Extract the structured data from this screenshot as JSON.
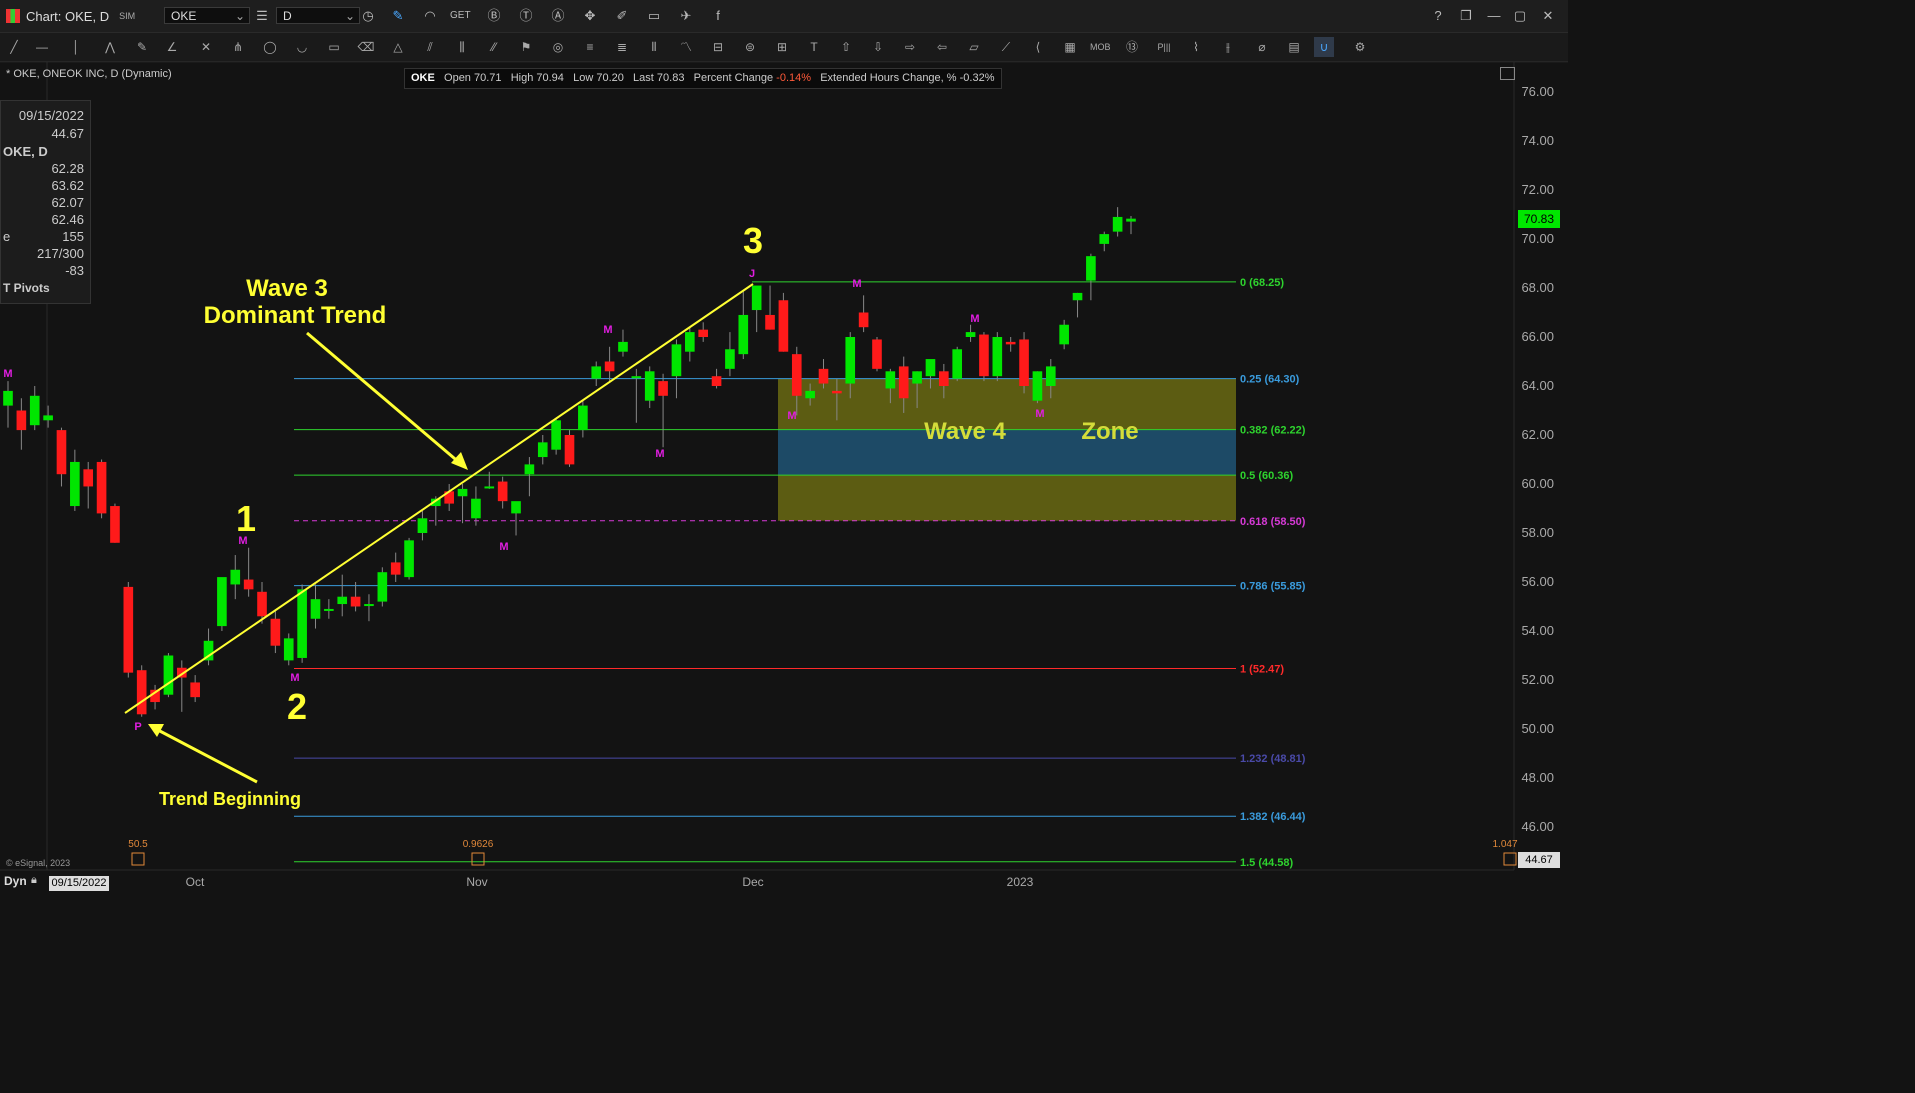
{
  "window": {
    "title": "Chart: OKE, D",
    "sim_label": "SIM",
    "symbol_value": "OKE",
    "interval_value": "D",
    "toolbar_icons": [
      "pencil-icon",
      "chart-type-icon",
      "get-icon",
      "b-icon",
      "t-icon",
      "a-icon",
      "magnet-tool-icon",
      "note-icon",
      "comment-icon",
      "twitter-icon",
      "facebook-icon"
    ],
    "window_buttons": [
      "help-icon",
      "restore-icon",
      "minimize-icon",
      "maximize-icon",
      "close-icon"
    ]
  },
  "chart_header": {
    "subtitle": "* OKE, ONEOK INC, D (Dynamic)",
    "symbol": "OKE",
    "open_label": "Open",
    "open": "70.71",
    "high_label": "High",
    "high": "70.94",
    "low_label": "Low",
    "low": "70.20",
    "last_label": "Last",
    "last": "70.83",
    "pct_change_label": "Percent Change",
    "pct_change": "-0.14%",
    "ext_change_label": "Extended Hours Change, %",
    "ext_change": "-0.32%"
  },
  "data_window": {
    "date": "09/15/2022",
    "line1": "44.67",
    "symbol_line": "OKE, D",
    "values": [
      "62.28",
      "63.62",
      "62.07",
      "62.46"
    ],
    "vol_label": "e",
    "vol": "155",
    "count": "217/300",
    "change": "-83",
    "study": "T Pivots"
  },
  "status": {
    "dyn": "Dyn",
    "date": "09/15/2022",
    "copyright": "© eSignal, 2023",
    "last_price_tag": "70.83",
    "bottom_tag": "44.67",
    "left_indicator": "50.5",
    "mid_indicator": "0.9626",
    "right_indicator": "1.047"
  },
  "colors": {
    "up_candle": "#00e600",
    "down_candle": "#ff1a1a",
    "annotation": "#ffff33",
    "pivot_marker": "#e01ee0",
    "zone_fill": "#5c5c12",
    "zone_mid_fill": "#1d4a66"
  },
  "chart_data": {
    "type": "candlestick",
    "symbol": "OKE",
    "interval": "D",
    "y_axis_ticks": [
      "76.00",
      "74.00",
      "72.00",
      "70.00",
      "68.00",
      "66.00",
      "64.00",
      "62.00",
      "60.00",
      "58.00",
      "56.00",
      "54.00",
      "52.00",
      "50.00",
      "48.00",
      "46.00"
    ],
    "ylim": [
      45.0,
      76.8
    ],
    "x_axis_labels": [
      "Oct",
      "Nov",
      "Dec",
      "2023"
    ],
    "fib_levels": [
      {
        "ratio": "0",
        "price": "68.25",
        "label": "0 (68.25)",
        "color": "#2ed32e"
      },
      {
        "ratio": "0.25",
        "price": "64.30",
        "label": "0.25 (64.30)",
        "color": "#3a9bdc"
      },
      {
        "ratio": "0.382",
        "price": "62.22",
        "label": "0.382 (62.22)",
        "color": "#2ed32e"
      },
      {
        "ratio": "0.5",
        "price": "60.36",
        "label": "0.5 (60.36)",
        "color": "#2ed32e"
      },
      {
        "ratio": "0.618",
        "price": "58.50",
        "label": "0.618 (58.50)",
        "color": "#d63ad6"
      },
      {
        "ratio": "0.786",
        "price": "55.85",
        "label": "0.786 (55.85)",
        "color": "#3a9bdc"
      },
      {
        "ratio": "1",
        "price": "52.47",
        "label": "1 (52.47)",
        "color": "#ff2a2a"
      },
      {
        "ratio": "1.232",
        "price": "48.81",
        "label": "1.232 (48.81)",
        "color": "#4a4aa8"
      },
      {
        "ratio": "1.382",
        "price": "46.44",
        "label": "1.382 (46.44)",
        "color": "#3a9bdc"
      },
      {
        "ratio": "1.5",
        "price": "44.58",
        "label": "1.5 (44.58)",
        "color": "#2ed32e"
      }
    ],
    "candles": [
      {
        "o": 63.2,
        "h": 64.2,
        "l": 62.3,
        "c": 63.8
      },
      {
        "o": 63.0,
        "h": 63.5,
        "l": 61.4,
        "c": 62.2
      },
      {
        "o": 62.4,
        "h": 64.0,
        "l": 62.2,
        "c": 63.6
      },
      {
        "o": 62.6,
        "h": 63.2,
        "l": 62.3,
        "c": 62.8
      },
      {
        "o": 62.2,
        "h": 62.3,
        "l": 59.9,
        "c": 60.4
      },
      {
        "o": 59.1,
        "h": 61.4,
        "l": 58.9,
        "c": 60.9
      },
      {
        "o": 60.6,
        "h": 60.9,
        "l": 59.0,
        "c": 59.9
      },
      {
        "o": 60.9,
        "h": 61.0,
        "l": 58.6,
        "c": 58.8
      },
      {
        "o": 59.1,
        "h": 59.2,
        "l": 57.6,
        "c": 57.6
      },
      {
        "o": 55.8,
        "h": 56.0,
        "l": 52.1,
        "c": 52.3
      },
      {
        "o": 52.4,
        "h": 52.6,
        "l": 50.5,
        "c": 50.6
      },
      {
        "o": 51.6,
        "h": 51.8,
        "l": 50.8,
        "c": 51.1
      },
      {
        "o": 51.4,
        "h": 53.1,
        "l": 51.3,
        "c": 53.0
      },
      {
        "o": 52.5,
        "h": 52.8,
        "l": 50.7,
        "c": 52.1
      },
      {
        "o": 51.9,
        "h": 52.2,
        "l": 51.1,
        "c": 51.3
      },
      {
        "o": 52.8,
        "h": 54.1,
        "l": 52.6,
        "c": 53.6
      },
      {
        "o": 54.2,
        "h": 55.8,
        "l": 54.0,
        "c": 56.2
      },
      {
        "o": 55.9,
        "h": 57.1,
        "l": 55.3,
        "c": 56.5
      },
      {
        "o": 56.1,
        "h": 57.4,
        "l": 55.4,
        "c": 55.7
      },
      {
        "o": 55.6,
        "h": 56.0,
        "l": 54.3,
        "c": 54.6
      },
      {
        "o": 54.5,
        "h": 54.8,
        "l": 53.1,
        "c": 53.4
      },
      {
        "o": 52.8,
        "h": 53.9,
        "l": 52.6,
        "c": 53.7
      },
      {
        "o": 52.9,
        "h": 55.9,
        "l": 52.7,
        "c": 55.7
      },
      {
        "o": 54.5,
        "h": 55.9,
        "l": 54.1,
        "c": 55.3
      },
      {
        "o": 54.9,
        "h": 55.3,
        "l": 54.5,
        "c": 54.9
      },
      {
        "o": 55.1,
        "h": 56.3,
        "l": 54.6,
        "c": 55.4
      },
      {
        "o": 55.4,
        "h": 56.0,
        "l": 54.8,
        "c": 55.0
      },
      {
        "o": 55.1,
        "h": 55.5,
        "l": 54.4,
        "c": 55.1
      },
      {
        "o": 55.2,
        "h": 56.6,
        "l": 55.0,
        "c": 56.4
      },
      {
        "o": 56.8,
        "h": 57.2,
        "l": 56.0,
        "c": 56.3
      },
      {
        "o": 56.2,
        "h": 57.8,
        "l": 56.1,
        "c": 57.7
      },
      {
        "o": 58.0,
        "h": 58.9,
        "l": 57.7,
        "c": 58.6
      },
      {
        "o": 59.1,
        "h": 59.5,
        "l": 58.3,
        "c": 59.4
      },
      {
        "o": 59.7,
        "h": 60.0,
        "l": 58.9,
        "c": 59.2
      },
      {
        "o": 59.5,
        "h": 60.0,
        "l": 58.4,
        "c": 59.8
      },
      {
        "o": 58.6,
        "h": 59.9,
        "l": 58.3,
        "c": 59.4
      },
      {
        "o": 59.9,
        "h": 60.5,
        "l": 59.8,
        "c": 59.9
      },
      {
        "o": 60.1,
        "h": 60.3,
        "l": 59.0,
        "c": 59.3
      },
      {
        "o": 58.8,
        "h": 59.2,
        "l": 57.9,
        "c": 59.3
      },
      {
        "o": 60.4,
        "h": 61.1,
        "l": 59.5,
        "c": 60.8
      },
      {
        "o": 61.1,
        "h": 62.0,
        "l": 60.8,
        "c": 61.7
      },
      {
        "o": 61.4,
        "h": 62.7,
        "l": 61.2,
        "c": 62.6
      },
      {
        "o": 62.0,
        "h": 62.2,
        "l": 60.7,
        "c": 60.8
      },
      {
        "o": 62.2,
        "h": 63.4,
        "l": 61.9,
        "c": 63.2
      },
      {
        "o": 64.3,
        "h": 65.0,
        "l": 64.0,
        "c": 64.8
      },
      {
        "o": 65.0,
        "h": 65.6,
        "l": 64.2,
        "c": 64.6
      },
      {
        "o": 65.4,
        "h": 66.3,
        "l": 65.2,
        "c": 65.8
      },
      {
        "o": 64.4,
        "h": 64.7,
        "l": 62.5,
        "c": 64.4
      },
      {
        "o": 63.4,
        "h": 64.8,
        "l": 63.1,
        "c": 64.6
      },
      {
        "o": 64.2,
        "h": 64.5,
        "l": 61.5,
        "c": 63.6
      },
      {
        "o": 64.4,
        "h": 65.9,
        "l": 63.5,
        "c": 65.7
      },
      {
        "o": 65.4,
        "h": 66.4,
        "l": 65.0,
        "c": 66.2
      },
      {
        "o": 66.3,
        "h": 66.6,
        "l": 65.8,
        "c": 66.0
      },
      {
        "o": 64.4,
        "h": 64.7,
        "l": 63.9,
        "c": 64.0
      },
      {
        "o": 64.7,
        "h": 66.2,
        "l": 64.4,
        "c": 65.5
      },
      {
        "o": 65.3,
        "h": 67.9,
        "l": 65.1,
        "c": 66.9
      },
      {
        "o": 67.1,
        "h": 67.4,
        "l": 66.2,
        "c": 68.1
      },
      {
        "o": 66.9,
        "h": 68.1,
        "l": 66.3,
        "c": 66.3
      },
      {
        "o": 67.5,
        "h": 67.8,
        "l": 65.4,
        "c": 65.4
      },
      {
        "o": 65.3,
        "h": 65.6,
        "l": 62.8,
        "c": 63.6
      },
      {
        "o": 63.5,
        "h": 64.1,
        "l": 63.2,
        "c": 63.8
      },
      {
        "o": 64.7,
        "h": 65.1,
        "l": 63.9,
        "c": 64.1
      },
      {
        "o": 63.8,
        "h": 64.3,
        "l": 62.6,
        "c": 63.7
      },
      {
        "o": 64.1,
        "h": 66.2,
        "l": 63.5,
        "c": 66.0
      },
      {
        "o": 67.0,
        "h": 67.7,
        "l": 66.2,
        "c": 66.4
      },
      {
        "o": 65.9,
        "h": 66.0,
        "l": 64.6,
        "c": 64.7
      },
      {
        "o": 63.9,
        "h": 64.7,
        "l": 63.3,
        "c": 64.6
      },
      {
        "o": 64.8,
        "h": 65.2,
        "l": 62.9,
        "c": 63.5
      },
      {
        "o": 64.1,
        "h": 64.6,
        "l": 63.1,
        "c": 64.6
      },
      {
        "o": 64.4,
        "h": 65.0,
        "l": 63.9,
        "c": 65.1
      },
      {
        "o": 64.6,
        "h": 64.9,
        "l": 63.5,
        "c": 64.0
      },
      {
        "o": 64.3,
        "h": 65.6,
        "l": 64.2,
        "c": 65.5
      },
      {
        "o": 66.0,
        "h": 66.5,
        "l": 65.8,
        "c": 66.2
      },
      {
        "o": 66.1,
        "h": 66.2,
        "l": 64.2,
        "c": 64.4
      },
      {
        "o": 64.4,
        "h": 66.2,
        "l": 64.2,
        "c": 66.0
      },
      {
        "o": 65.8,
        "h": 66.0,
        "l": 65.4,
        "c": 65.7
      },
      {
        "o": 65.9,
        "h": 66.2,
        "l": 63.7,
        "c": 64.0
      },
      {
        "o": 63.4,
        "h": 64.6,
        "l": 63.3,
        "c": 64.6
      },
      {
        "o": 64.0,
        "h": 65.1,
        "l": 63.5,
        "c": 64.8
      },
      {
        "o": 65.7,
        "h": 66.7,
        "l": 65.5,
        "c": 66.5
      },
      {
        "o": 67.5,
        "h": 67.8,
        "l": 66.8,
        "c": 67.8
      },
      {
        "o": 68.3,
        "h": 69.4,
        "l": 67.5,
        "c": 69.3
      },
      {
        "o": 69.8,
        "h": 70.3,
        "l": 69.5,
        "c": 70.2
      },
      {
        "o": 70.3,
        "h": 71.3,
        "l": 70.1,
        "c": 70.9
      },
      {
        "o": 70.71,
        "h": 70.94,
        "l": 70.2,
        "c": 70.83
      }
    ],
    "annotations": {
      "wave1": "1",
      "wave2": "2",
      "wave3": "3",
      "wave3_caption": [
        "Wave 3",
        "Dominant Trend"
      ],
      "trend_caption": "Trend Beginning",
      "wave4_caption": "Wave 4",
      "zone_caption": "Zone",
      "pivot_p": "P",
      "pivot_j": "J",
      "pivot_m": "M"
    }
  }
}
